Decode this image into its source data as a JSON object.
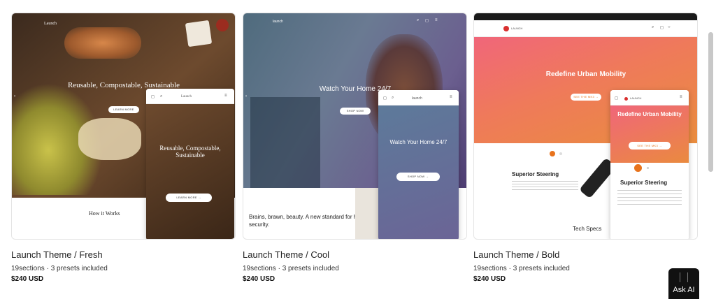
{
  "cards": [
    {
      "title": "Launch Theme / Fresh",
      "sections": "19sections · 3 presets included",
      "price": "$240 USD",
      "preview": {
        "brand": "Launch",
        "headline": "Reusable, Compostable, Sustainable",
        "button": "LEARN MORE",
        "phone_headline": "Reusable, Compostable, Sustainable",
        "phone_button": "LEARN MORE →",
        "phone_brand": "Launch",
        "section_title": "How it Works"
      }
    },
    {
      "title": "Launch Theme / Cool",
      "sections": "19sections · 3 presets included",
      "price": "$240 USD",
      "preview": {
        "brand": "launch",
        "headline": "Watch Your Home 24/7",
        "button": "SHOP NOW",
        "phone_headline": "Watch Your Home 24/7",
        "phone_button": "SHOP NOW →",
        "phone_brand": "launch",
        "lower_text": "Brains, brawn, beauty. A new standard for home security."
      }
    },
    {
      "title": "Launch Theme / Bold",
      "sections": "19sections · 3 presets included",
      "price": "$240 USD",
      "preview": {
        "brand": "LAUNCH",
        "headline": "Redefine Urban Mobility",
        "button": "SEE THE MK3 →",
        "phone_headline": "Redefine Urban Mobility",
        "phone_button": "SEE THE MK3 →",
        "phone_brand": "LAUNCH",
        "feature": "Superior Steering",
        "phone_feature": "Superior Steering",
        "specs": "Tech Specs"
      }
    }
  ],
  "ask_ai": {
    "label": "Ask AI"
  },
  "colors": {
    "bold_accent": "#e8731c",
    "fresh_wood": "#5c3f28",
    "cool_tint": "#6a7a92"
  }
}
